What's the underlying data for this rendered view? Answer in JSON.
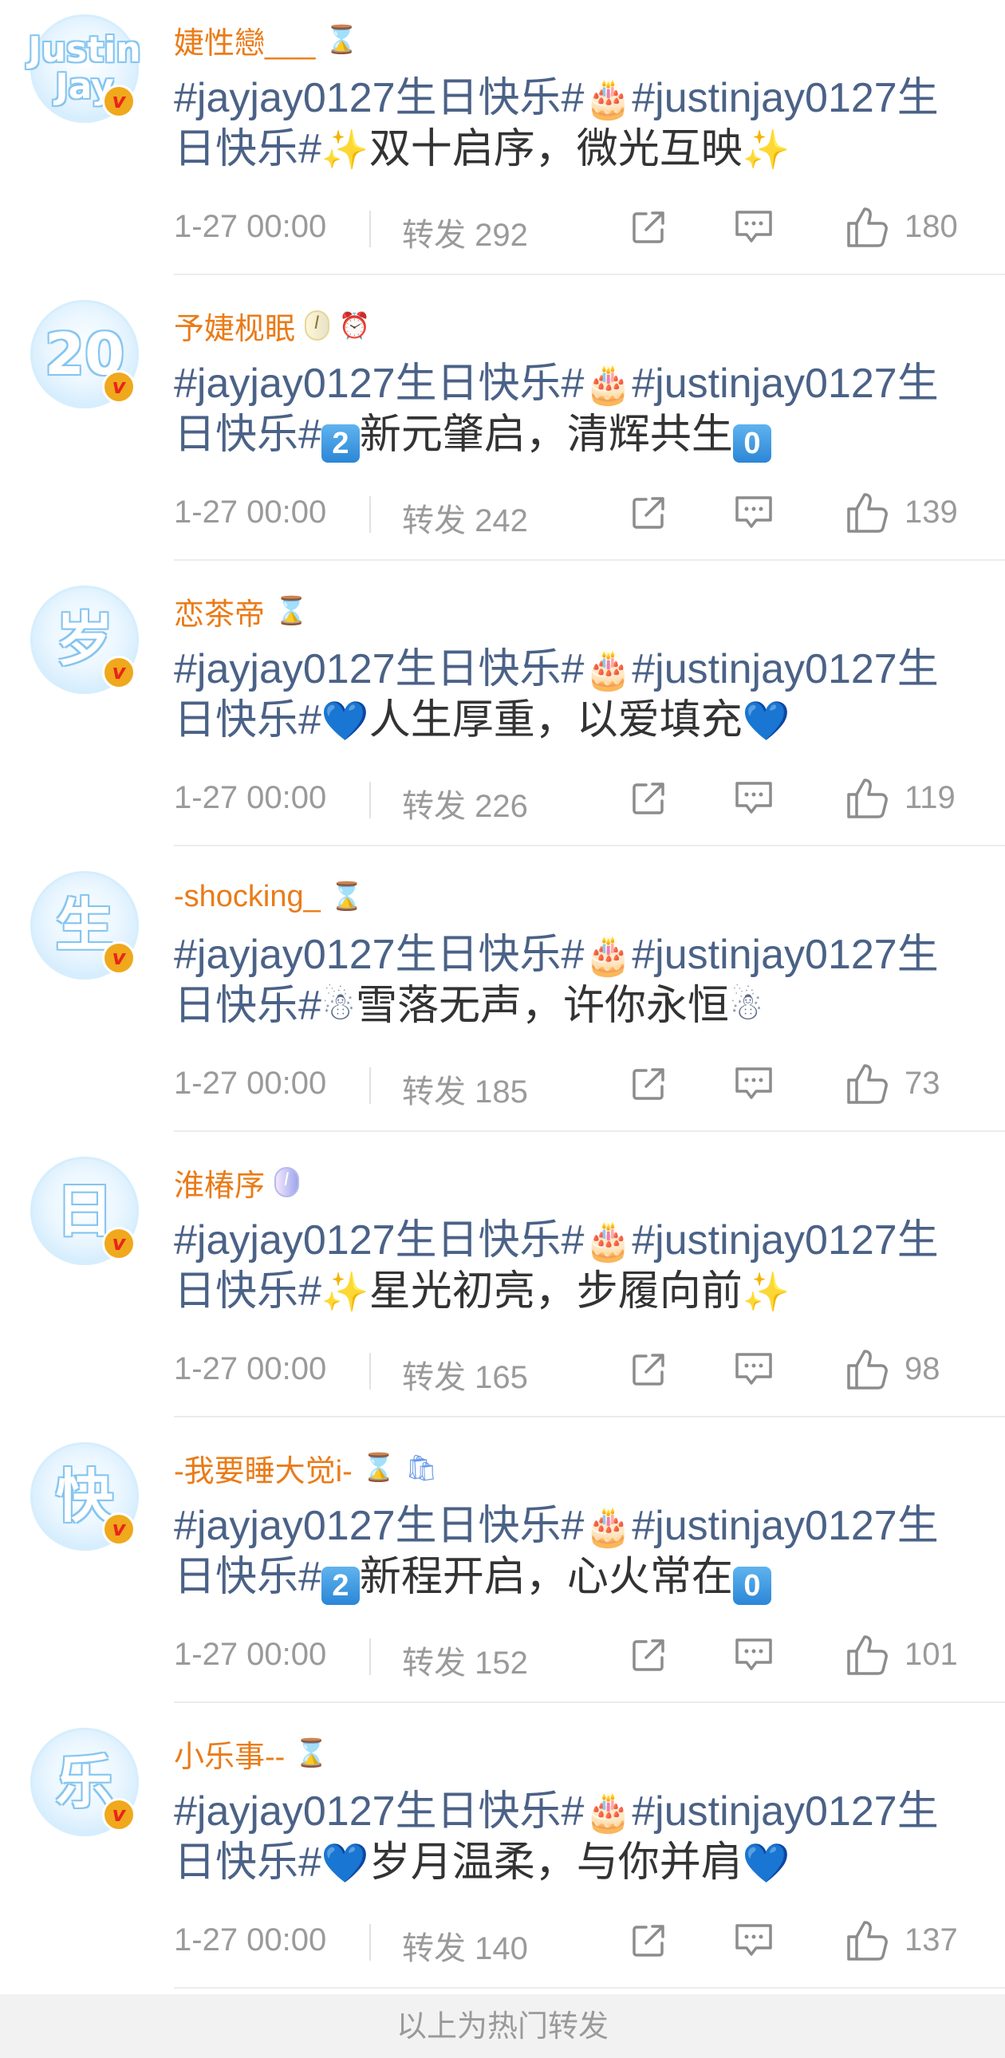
{
  "reposts": [
    {
      "avatar_text": "Justin Jay",
      "username": "婕性戀___",
      "badges": [
        "hourglass"
      ],
      "content": [
        {
          "t": "tag",
          "v": "#jayjay0127生日快乐#"
        },
        {
          "t": "emoji",
          "v": "🎂"
        },
        {
          "t": "tag",
          "v": "#justinjay0127生日快乐#"
        },
        {
          "t": "emoji",
          "v": "✨"
        },
        {
          "t": "plain",
          "v": "双十启序，微光互映"
        },
        {
          "t": "emoji",
          "v": "✨"
        }
      ],
      "time": "1-27 00:00",
      "repost_label": "转发 292",
      "likes": "180"
    },
    {
      "avatar_text": "20",
      "username": "予婕枧眠",
      "badges": [
        "medal",
        "alarm-clock"
      ],
      "medal_text": "I",
      "content": [
        {
          "t": "tag",
          "v": "#jayjay0127生日快乐#"
        },
        {
          "t": "emoji",
          "v": "🎂"
        },
        {
          "t": "tag",
          "v": "#justinjay0127生日快乐#"
        },
        {
          "t": "keycap",
          "v": "2"
        },
        {
          "t": "plain",
          "v": "新元肇启，清辉共生"
        },
        {
          "t": "keycap",
          "v": "0"
        }
      ],
      "time": "1-27 00:00",
      "repost_label": "转发 242",
      "likes": "139"
    },
    {
      "avatar_text": "岁",
      "username": "恋茶帝",
      "badges": [
        "hourglass"
      ],
      "content": [
        {
          "t": "tag",
          "v": "#jayjay0127生日快乐#"
        },
        {
          "t": "emoji",
          "v": "🎂"
        },
        {
          "t": "tag",
          "v": "#justinjay0127生日快乐#"
        },
        {
          "t": "emoji",
          "v": "💙"
        },
        {
          "t": "plain",
          "v": "人生厚重，以爱填充"
        },
        {
          "t": "emoji",
          "v": "💙"
        }
      ],
      "time": "1-27 00:00",
      "repost_label": "转发 226",
      "likes": "119"
    },
    {
      "avatar_text": "生",
      "username": "-shocking_",
      "badges": [
        "hourglass"
      ],
      "content": [
        {
          "t": "tag",
          "v": "#jayjay0127生日快乐#"
        },
        {
          "t": "emoji",
          "v": "🎂"
        },
        {
          "t": "tag",
          "v": "#justinjay0127生日快乐#"
        },
        {
          "t": "emoji",
          "v": "☃"
        },
        {
          "t": "plain",
          "v": "雪落无声，许你永恒"
        },
        {
          "t": "emoji",
          "v": "☃"
        }
      ],
      "time": "1-27 00:00",
      "repost_label": "转发 185",
      "likes": "73"
    },
    {
      "avatar_text": "日",
      "username": "淮椿序",
      "badges": [
        "medal-purple"
      ],
      "medal_text": "I",
      "content": [
        {
          "t": "tag",
          "v": "#jayjay0127生日快乐#"
        },
        {
          "t": "emoji",
          "v": "🎂"
        },
        {
          "t": "tag",
          "v": "#justinjay0127生日快乐#"
        },
        {
          "t": "emoji",
          "v": "✨"
        },
        {
          "t": "plain",
          "v": "星光初亮，步履向前"
        },
        {
          "t": "emoji",
          "v": "✨"
        }
      ],
      "time": "1-27 00:00",
      "repost_label": "转发 165",
      "likes": "98"
    },
    {
      "avatar_text": "快",
      "username": "-我要睡大觉i-",
      "badges": [
        "hourglass",
        "shopping-bag"
      ],
      "content": [
        {
          "t": "tag",
          "v": "#jayjay0127生日快乐#"
        },
        {
          "t": "emoji",
          "v": "🎂"
        },
        {
          "t": "tag",
          "v": "#justinjay0127生日快乐#"
        },
        {
          "t": "keycap",
          "v": "2"
        },
        {
          "t": "plain",
          "v": "新程开启，心火常在"
        },
        {
          "t": "keycap",
          "v": "0"
        }
      ],
      "time": "1-27 00:00",
      "repost_label": "转发 152",
      "likes": "101"
    },
    {
      "avatar_text": "乐",
      "username": "小乐事--",
      "badges": [
        "hourglass"
      ],
      "content": [
        {
          "t": "tag",
          "v": "#jayjay0127生日快乐#"
        },
        {
          "t": "emoji",
          "v": "🎂"
        },
        {
          "t": "tag",
          "v": "#justinjay0127生日快乐#"
        },
        {
          "t": "emoji",
          "v": "💙"
        },
        {
          "t": "plain",
          "v": "岁月温柔，与你并肩"
        },
        {
          "t": "emoji",
          "v": "💙"
        }
      ],
      "time": "1-27 00:00",
      "repost_label": "转发 140",
      "likes": "137"
    }
  ],
  "footer_text": "以上为热门转发",
  "colors": {
    "username": "#ea7b18",
    "topic": "#4b6287",
    "meta": "#9a9a9a",
    "verified": "#f0a81c"
  }
}
